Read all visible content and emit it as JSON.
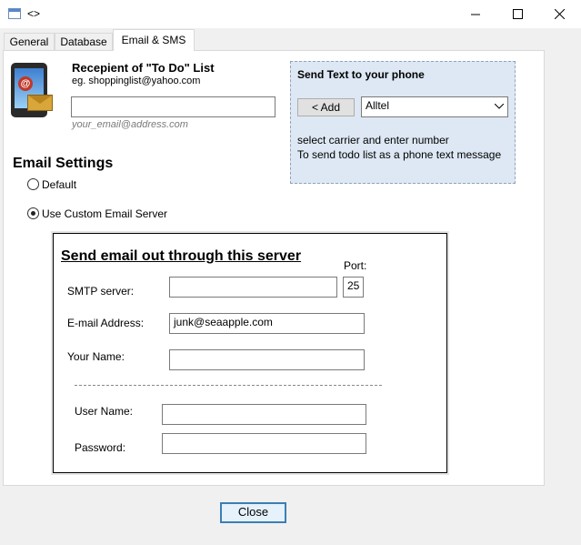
{
  "window": {
    "title": "<>",
    "minimize_icon": "minimize-icon",
    "maximize_icon": "maximize-icon",
    "close_icon": "close-icon"
  },
  "tabs": [
    {
      "label": "General"
    },
    {
      "label": "Database"
    },
    {
      "label": "Email & SMS",
      "active": true
    }
  ],
  "recipient": {
    "title": "Recepient of \"To Do\" List",
    "example": "eg. shoppinglist@yahoo.com",
    "email_value": "",
    "hint": "your_email@address.com"
  },
  "sms": {
    "title": "Send Text to your phone",
    "add_button": "< Add",
    "carrier_selected": "Alltel",
    "line1": "select carrier and enter number",
    "line2": "To send todo list as a phone text message"
  },
  "email_settings": {
    "title": "Email Settings",
    "option_default": "Default",
    "option_custom": "Use Custom Email Server",
    "selected": "custom"
  },
  "server": {
    "title": "Send email out through this server",
    "port_label": "Port:",
    "port_value": "25",
    "smtp_label": "SMTP server:",
    "smtp_value": "",
    "email_label": "E-mail Address:",
    "email_value": "junk@seaapple.com",
    "name_label": "Your Name:",
    "name_value": "",
    "username_label": "User Name:",
    "username_value": "",
    "password_label": "Password:",
    "password_value": ""
  },
  "footer": {
    "close_button": "Close"
  }
}
